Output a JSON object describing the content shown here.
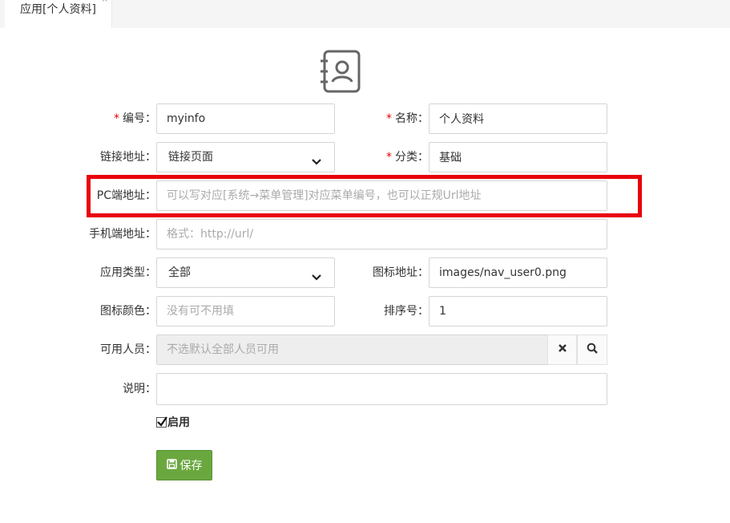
{
  "tab": {
    "title": "应用[个人资料]",
    "close_glyph": "×"
  },
  "form": {
    "code": {
      "required_mark": "*",
      "label": "编号：",
      "value": "myinfo"
    },
    "name": {
      "required_mark": "*",
      "label": "名称：",
      "value": "个人资料"
    },
    "link": {
      "label": "链接地址：",
      "value": "链接页面"
    },
    "category": {
      "required_mark": "*",
      "label": "分类：",
      "value": "基础"
    },
    "pc_url": {
      "label": "PC端地址：",
      "placeholder": "可以写对应[系统→菜单管理]对应菜单编号，也可以正规Url地址"
    },
    "mobile_url": {
      "label": "手机端地址：",
      "placeholder": "格式：http://url/"
    },
    "app_type": {
      "label": "应用类型：",
      "value": "全部"
    },
    "icon_url": {
      "label": "图标地址：",
      "value": "images/nav_user0.png"
    },
    "icon_color": {
      "label": "图标颜色：",
      "placeholder": "没有可不用填"
    },
    "sort_no": {
      "label": "排序号：",
      "value": "1"
    },
    "users": {
      "label": "可用人员：",
      "placeholder": "不选默认全部人员可用"
    },
    "description": {
      "label": "说明："
    },
    "enabled": {
      "label": "启用",
      "checked": true
    },
    "save": {
      "label": "保存"
    }
  },
  "colors": {
    "highlight": "#e8000b",
    "save_button": "#6aa83f",
    "required": "#e00000"
  }
}
